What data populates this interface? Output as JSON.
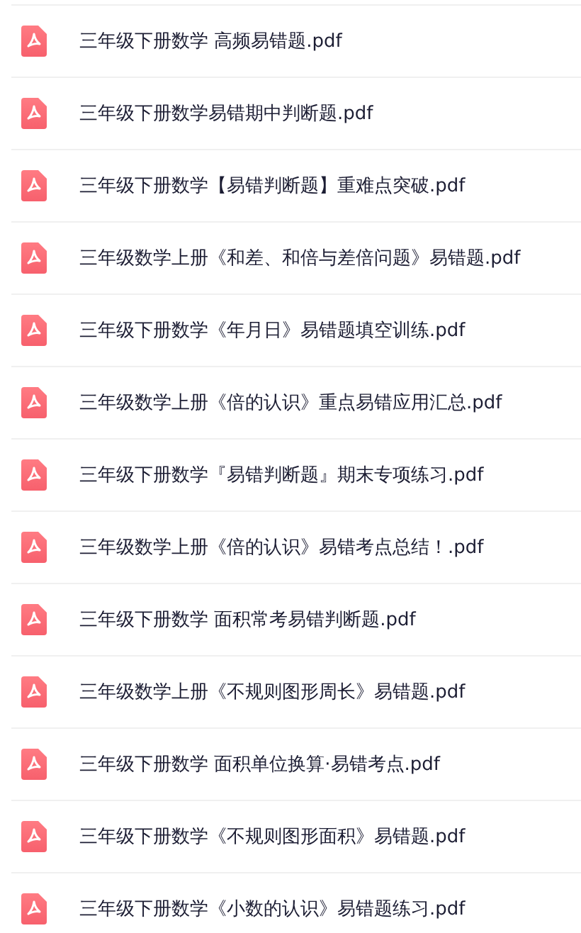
{
  "files": [
    {
      "name": "三年级下册数学 高频易错题.pdf"
    },
    {
      "name": "三年级下册数学易错期中判断题.pdf"
    },
    {
      "name": "三年级下册数学【易错判断题】重难点突破.pdf"
    },
    {
      "name": "三年级数学上册《和差、和倍与差倍问题》易错题.pdf"
    },
    {
      "name": "三年级下册数学《年月日》易错题填空训练.pdf"
    },
    {
      "name": "三年级数学上册《倍的认识》重点易错应用汇总.pdf"
    },
    {
      "name": "三年级下册数学『易错判断题』期末专项练习.pdf"
    },
    {
      "name": "三年级数学上册《倍的认识》易错考点总结！.pdf"
    },
    {
      "name": "三年级下册数学 面积常考易错判断题.pdf"
    },
    {
      "name": "三年级数学上册《不规则图形周长》易错题.pdf"
    },
    {
      "name": "三年级下册数学 面积单位换算·易错考点.pdf"
    },
    {
      "name": "三年级下册数学《不规则图形面积》易错题.pdf"
    },
    {
      "name": "三年级下册数学《小数的认识》易错题练习.pdf"
    }
  ]
}
